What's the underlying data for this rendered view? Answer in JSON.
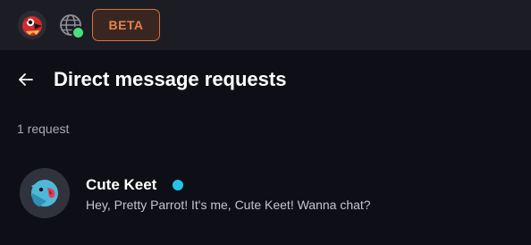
{
  "header": {
    "avatar_icon": "parrot-avatar-icon",
    "globe_icon": "globe-icon",
    "badge_label": "BETA",
    "colors": {
      "background": "#1c1d24",
      "badge_text": "#e3834b",
      "badge_border": "#d8713e",
      "status_online": "#4ade80"
    }
  },
  "page": {
    "back_icon": "arrow-left-icon",
    "title": "Direct message requests",
    "request_count_text": "1 request"
  },
  "requests": [
    {
      "name": "Cute Keet",
      "message": "Hey, Pretty Parrot! It's me, Cute Keet! Wanna chat?",
      "avatar_icon": "keet-avatar-icon",
      "status_color": "#22c4e8"
    }
  ],
  "colors": {
    "background": "#0e0f16",
    "muted_text": "#a7a8b1"
  }
}
